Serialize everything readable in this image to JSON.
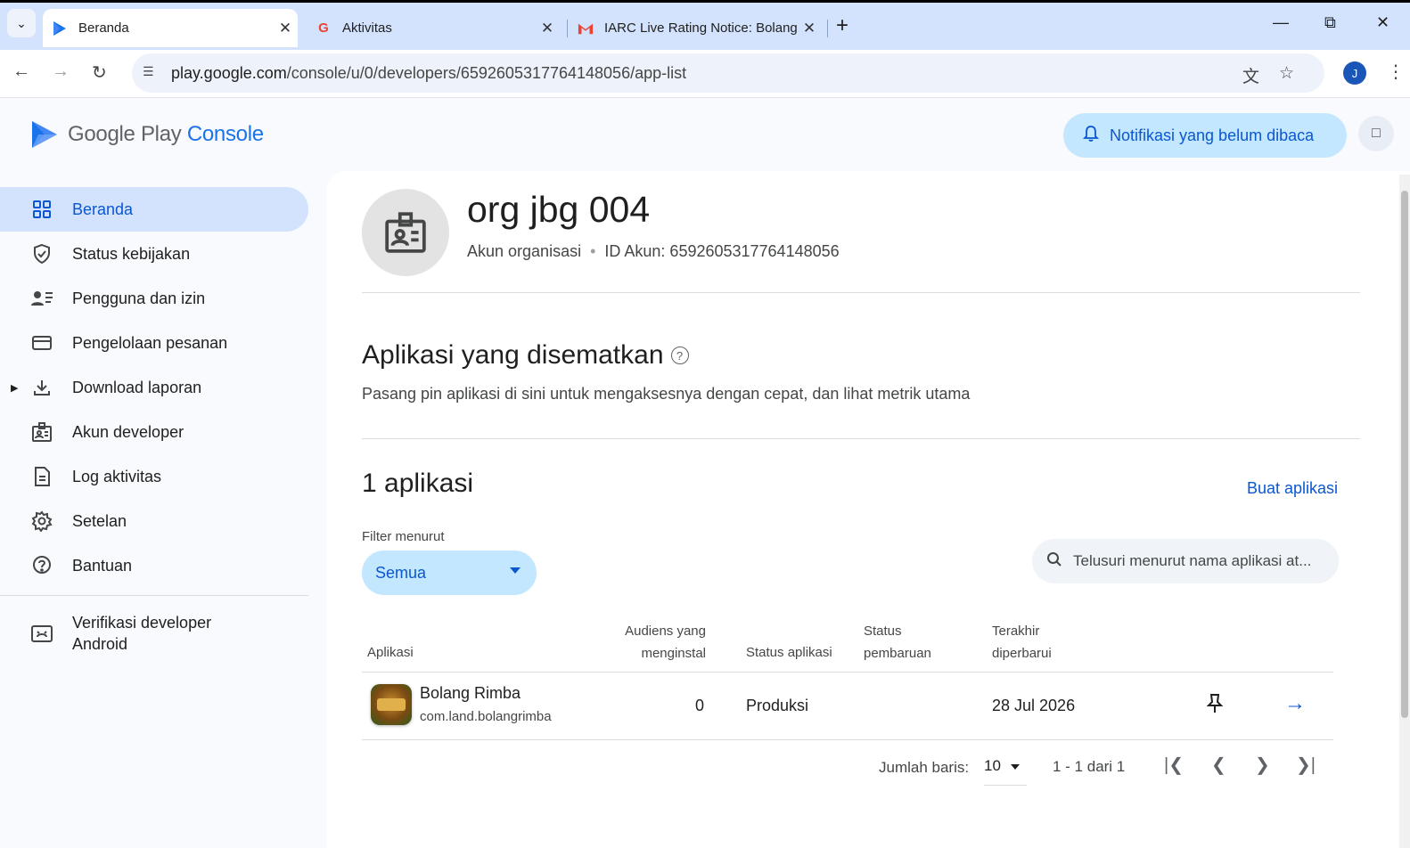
{
  "browser": {
    "tabs": [
      {
        "title": "Beranda",
        "favicon": "play-console-icon",
        "active": true
      },
      {
        "title": "Aktivitas",
        "favicon": "google-icon"
      },
      {
        "title": "IARC Live Rating Notice: Bolang",
        "favicon": "gmail-icon"
      }
    ],
    "url_domain": "play.google.com",
    "url_path": "/console/u/0/developers/6592605317764148056/app-list",
    "profile_initial": "J"
  },
  "header": {
    "logo_google_play": "Google Play",
    "logo_console": "Console",
    "notification_button": "Notifikasi yang belum dibaca"
  },
  "sidebar": {
    "items": [
      {
        "label": "Beranda",
        "icon": "grid-icon",
        "active": true
      },
      {
        "label": "Status kebijakan",
        "icon": "shield-check-icon"
      },
      {
        "label": "Pengguna dan izin",
        "icon": "users-list-icon"
      },
      {
        "label": "Pengelolaan pesanan",
        "icon": "credit-card-icon"
      },
      {
        "label": "Download laporan",
        "icon": "download-icon",
        "expandable": true
      },
      {
        "label": "Akun developer",
        "icon": "id-badge-icon"
      },
      {
        "label": "Log aktivitas",
        "icon": "document-icon"
      },
      {
        "label": "Setelan",
        "icon": "gear-icon"
      },
      {
        "label": "Bantuan",
        "icon": "help-icon"
      }
    ],
    "footer_item": {
      "line1": "Verifikasi developer",
      "line2": "Android",
      "icon": "android-verify-icon"
    }
  },
  "account": {
    "name": "org jbg 004",
    "type": "Akun organisasi",
    "id_text": "ID Akun: 6592605317764148056"
  },
  "pinned": {
    "title": "Aplikasi yang disematkan",
    "subtitle": "Pasang pin aplikasi di sini untuk mengaksesnya dengan cepat, dan lihat metrik utama"
  },
  "apps": {
    "count_title": "1 aplikasi",
    "create_link": "Buat aplikasi",
    "filter_label": "Filter menurut",
    "filter_value": "Semua",
    "search_placeholder": "Telusuri menurut nama aplikasi at...",
    "columns": {
      "app": "Aplikasi",
      "audience_1": "Audiens yang",
      "audience_2": "menginstal",
      "app_status": "Status aplikasi",
      "update_status_1": "Status",
      "update_status_2": "pembaruan",
      "last_updated_1": "Terakhir",
      "last_updated_2": "diperbarui"
    },
    "rows": [
      {
        "name": "Bolang Rimba",
        "package": "com.land.bolangrimba",
        "installs": "0",
        "status": "Produksi",
        "update_status": "",
        "last_updated": "28 Jul 2026"
      }
    ],
    "pager": {
      "rows_label": "Jumlah baris:",
      "rows_value": "10",
      "range": "1 - 1 dari 1"
    }
  },
  "colors": {
    "accent": "#0b57d0",
    "active_nav_bg": "#d3e3fd",
    "chip_bg": "#c2e7ff"
  }
}
